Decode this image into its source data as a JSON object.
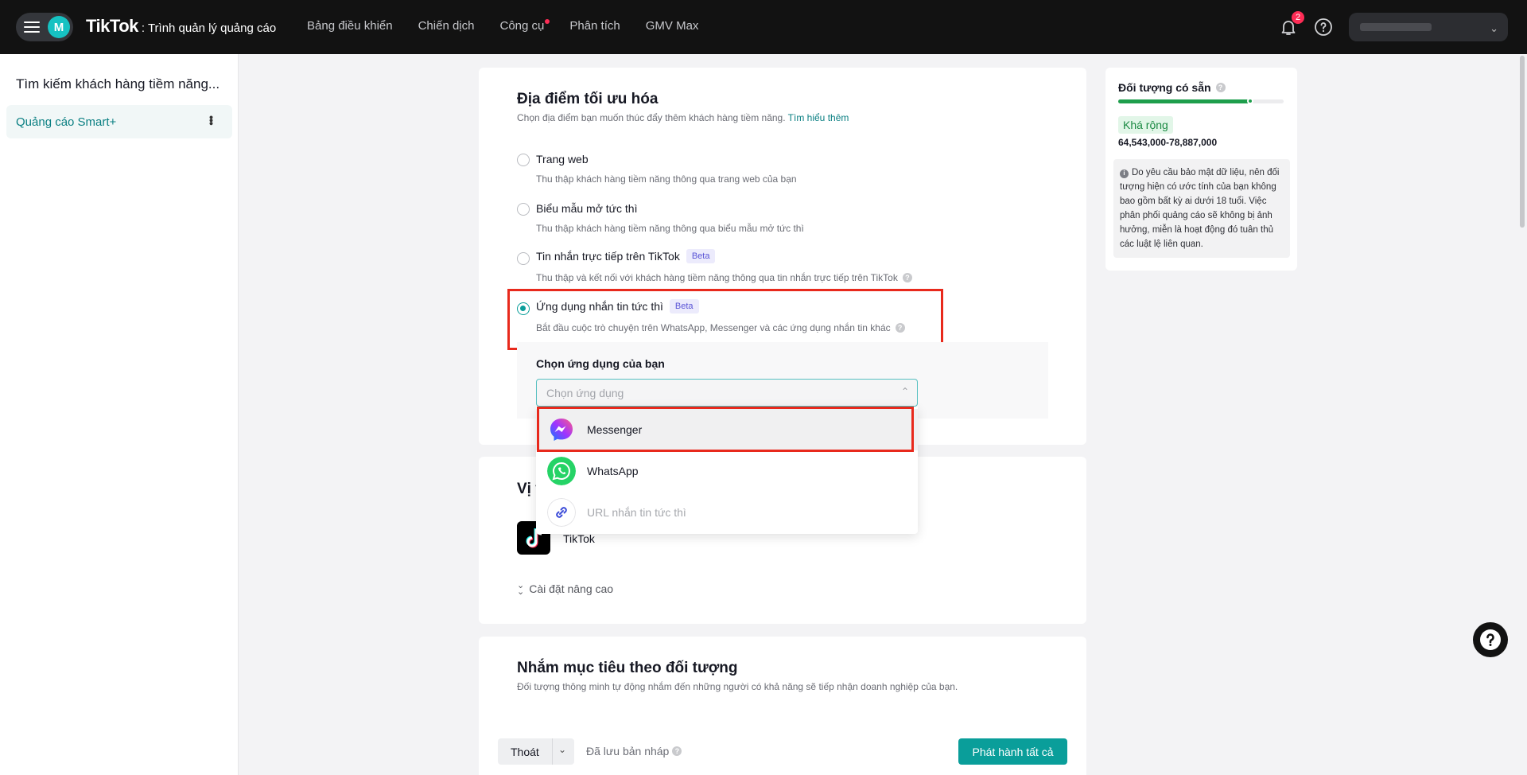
{
  "topbar": {
    "avatar_letter": "M",
    "logo_main": "TikTok",
    "logo_sub": ": Trình quản lý quảng cáo",
    "nav": [
      "Bảng điều khiển",
      "Chiến dịch",
      "Công cụ",
      "Phân tích",
      "GMV Max"
    ],
    "notification_count": "2"
  },
  "sidebar": {
    "title": "Tìm kiếm khách hàng tiềm năng...",
    "item_label": "Quảng cáo Smart+"
  },
  "location": {
    "title": "Địa điểm tối ưu hóa",
    "subtitle": "Chọn địa điểm bạn muốn thúc đẩy thêm khách hàng tiềm năng.",
    "learn_more": "Tìm hiểu thêm",
    "options": [
      {
        "title": "Trang web",
        "desc": "Thu thập khách hàng tiềm năng thông qua trang web của bạn",
        "selected": false
      },
      {
        "title": "Biểu mẫu mở tức thì",
        "desc": "Thu thập khách hàng tiềm năng thông qua biểu mẫu mở tức thì",
        "selected": false
      },
      {
        "title": "Tin nhắn trực tiếp trên TikTok",
        "badge": "Beta",
        "desc": "Thu thập và kết nối với khách hàng tiềm năng thông qua tin nhắn trực tiếp trên TikTok",
        "selected": false
      },
      {
        "title": "Ứng dụng nhắn tin tức thì",
        "badge": "Beta",
        "desc": "Bắt đầu cuộc trò chuyện trên WhatsApp, Messenger và các ứng dụng nhắn tin khác",
        "selected": true
      }
    ],
    "choose_app_label": "Chọn ứng dụng của bạn",
    "select_placeholder": "Chọn ứng dụng",
    "apps": [
      "Messenger",
      "WhatsApp",
      "URL nhắn tin tức thì"
    ]
  },
  "placement": {
    "title_partial": "Vị t",
    "platform": "TikTok",
    "advanced": "Cài đặt nâng cao"
  },
  "targeting": {
    "title": "Nhắm mục tiêu theo đối tượng",
    "subtitle": "Đối tượng thông minh tự động nhắm đến những người có khả năng sẽ tiếp nhận doanh nghiệp của bạn."
  },
  "audience": {
    "title": "Đối tượng có sẵn",
    "breadth_fraction": 0.8,
    "tag": "Khá rộng",
    "range": "64,543,000-78,887,000",
    "note": "Do yêu cầu bảo mật dữ liệu, nên đối tượng hiện có ước tính của bạn không bao gồm bất kỳ ai dưới 18 tuổi. Việc phân phối quảng cáo sẽ không bị ảnh hưởng, miễn là hoạt động đó tuân thủ các luật lệ liên quan."
  },
  "footer": {
    "exit": "Thoát",
    "saved": "Đã lưu bản nháp",
    "publish": "Phát hành tất cả"
  },
  "colors": {
    "accent": "#0a9e9a",
    "highlight_box": "#e8291c",
    "topbar": "#121212"
  }
}
